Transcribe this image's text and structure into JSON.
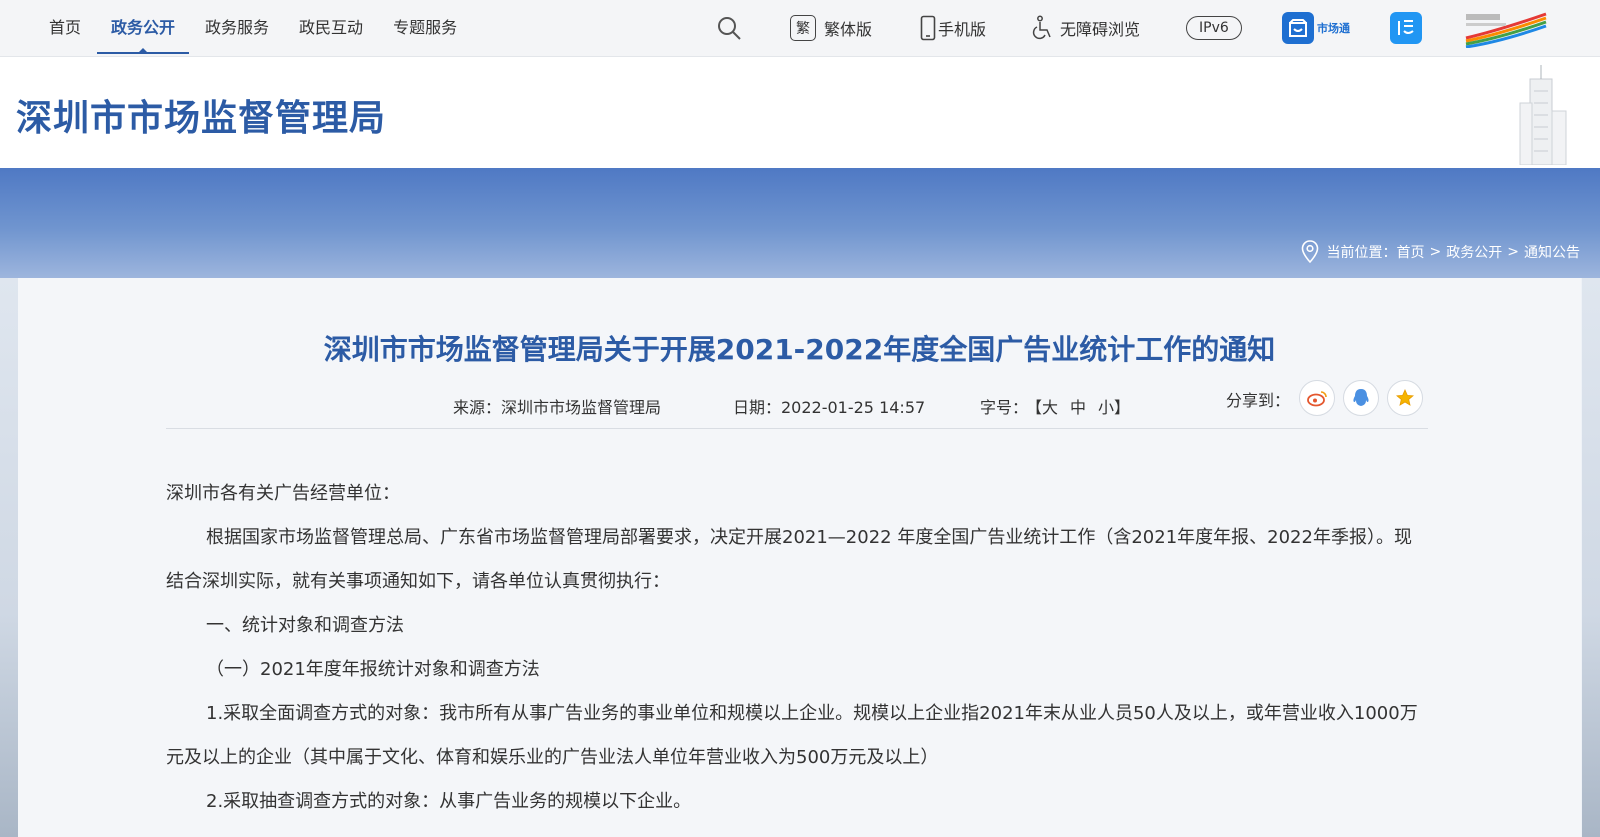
{
  "nav": {
    "items": [
      {
        "label": "首页"
      },
      {
        "label": "政务公开"
      },
      {
        "label": "政务服务"
      },
      {
        "label": "政民互动"
      },
      {
        "label": "专题服务"
      }
    ],
    "active_index": 1
  },
  "tools": {
    "search_icon": "search-icon",
    "traditional_glyph": "繁",
    "traditional_label": "繁体版",
    "mobile_label": "手机版",
    "accessibility_label": "无障碍浏览",
    "ipv6_label": "IPv6",
    "shichangtong_label": "市场通"
  },
  "header": {
    "site_title": "深圳市市场监督管理局"
  },
  "breadcrumb": {
    "prefix": "当前位置：",
    "items": [
      "首页",
      "政务公开",
      "通知公告"
    ],
    "separator": ">"
  },
  "article": {
    "title": "深圳市市场监督管理局关于开展2021-2022年度全国广告业统计工作的通知",
    "source": "来源：深圳市市场监督管理局",
    "date": "日期：2022-01-25 14:57",
    "font_size_label": "字号：",
    "font_sizes": [
      "【大",
      "中",
      "小】"
    ],
    "share_label": "分享到：",
    "paragraphs": [
      "深圳市各有关广告经营单位：",
      "根据国家市场监督管理总局、广东省市场监督管理局部署要求，决定开展2021—2022 年度全国广告业统计工作（含2021年度年报、2022年季报）。现结合深圳实际，就有关事项通知如下，请各单位认真贯彻执行：",
      "一、统计对象和调查方法",
      "（一）2021年度年报统计对象和调查方法",
      "1.采取全面调查方式的对象：我市所有从事广告业务的事业单位和规模以上企业。规模以上企业指2021年末从业人员50人及以上，或年营业收入1000万元及以上的企业（其中属于文化、体育和娱乐业的广告业法人单位年营业收入为500万元及以上）",
      "2.采取抽查调查方式的对象：从事广告业务的规模以下企业。"
    ]
  },
  "colors": {
    "brand_blue": "#2c5ba5",
    "banner_blue": "#5b83c8"
  }
}
